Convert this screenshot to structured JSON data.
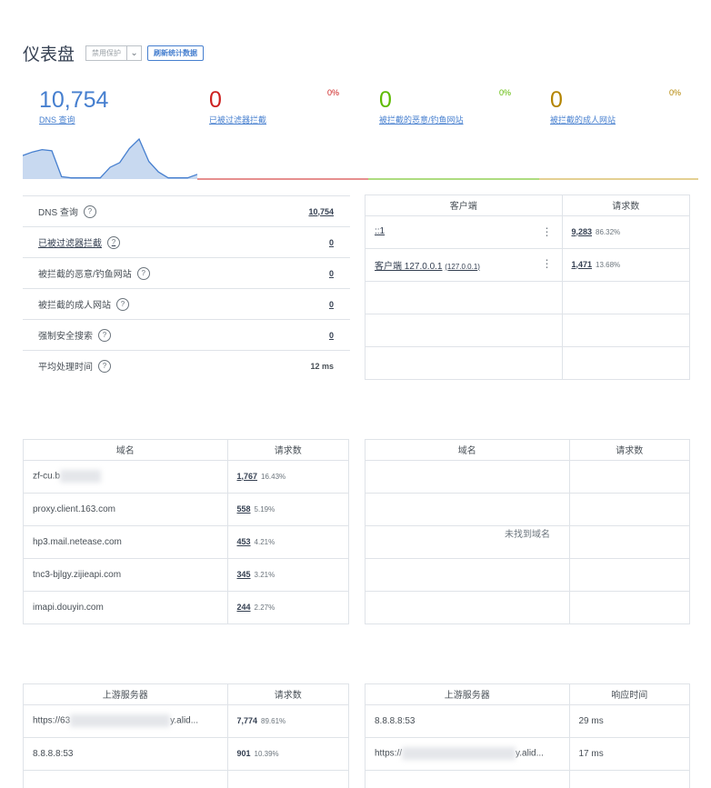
{
  "header": {
    "title": "仪表盘",
    "protection_label": "禁用保护",
    "refresh_label": "刷新统计数据"
  },
  "stats_tiles": {
    "dns": {
      "value": "10,754",
      "label": "DNS 查询"
    },
    "filtered": {
      "value": "0",
      "label": "已被过滤器拦截",
      "percent": "0%"
    },
    "malware": {
      "value": "0",
      "label": "被拦截的恶意/钓鱼网站",
      "percent": "0%"
    },
    "adult": {
      "value": "0",
      "label": "被拦截的成人网站",
      "percent": "0%"
    }
  },
  "sparkline": {
    "values": [
      20,
      23,
      25,
      24,
      2,
      1,
      1,
      1,
      1,
      10,
      14,
      26,
      34,
      15,
      6,
      1,
      1,
      1,
      4
    ]
  },
  "general_stats": [
    {
      "label": "DNS 查询",
      "value": "10,754",
      "label_link": false,
      "value_link": true
    },
    {
      "label": "已被过滤器拦截",
      "value": "0",
      "label_link": true,
      "value_link": true
    },
    {
      "label": "被拦截的恶意/钓鱼网站",
      "value": "0",
      "label_link": false,
      "value_link": true
    },
    {
      "label": "被拦截的成人网站",
      "value": "0",
      "label_link": false,
      "value_link": true
    },
    {
      "label": "强制安全搜索",
      "value": "0",
      "label_link": false,
      "value_link": true
    },
    {
      "label": "平均处理时间",
      "value": "12 ms",
      "label_link": false,
      "value_link": false
    }
  ],
  "help_icon": "?",
  "top_clients": {
    "col_client": "客户端",
    "col_requests": "请求数",
    "rows": [
      {
        "name": "::1",
        "sub": "",
        "count": "9,283",
        "percent": "86.32%"
      },
      {
        "name": "客户端 127.0.0.1",
        "sub": "(127.0.0.1)",
        "count": "1,471",
        "percent": "13.68%"
      }
    ]
  },
  "top_queried": {
    "col_domain": "域名",
    "col_requests": "请求数",
    "rows": [
      {
        "domain": "zf-cu.b",
        "count": "1,767",
        "percent": "16.43%"
      },
      {
        "domain": "proxy.client.163.com",
        "count": "558",
        "percent": "5.19%"
      },
      {
        "domain": "hp3.mail.netease.com",
        "count": "453",
        "percent": "4.21%"
      },
      {
        "domain": "tnc3-bjlgy.zijieapi.com",
        "count": "345",
        "percent": "3.21%"
      },
      {
        "domain": "imapi.douyin.com",
        "count": "244",
        "percent": "2.27%"
      }
    ]
  },
  "top_blocked": {
    "col_domain": "域名",
    "col_requests": "请求数",
    "empty": "未找到域名"
  },
  "upstreams": {
    "col_server": "上游服务器",
    "col_requests": "请求数",
    "rows": [
      {
        "server_prefix": "https://63",
        "server_suffix": "y.alid...",
        "count": "7,774",
        "percent": "89.61%"
      },
      {
        "server_prefix": "8.8.8.8:53",
        "server_suffix": "",
        "count": "901",
        "percent": "10.39%"
      }
    ]
  },
  "upstream_times": {
    "col_server": "上游服务器",
    "col_time": "响应时间",
    "rows": [
      {
        "server_prefix": "8.8.8.8:53",
        "server_suffix": "",
        "time": "29 ms"
      },
      {
        "server_prefix": "https://",
        "server_suffix": "y.alid...",
        "time": "17 ms"
      }
    ]
  },
  "colors": {
    "blue": "#467fcf",
    "red": "#cd201f",
    "green": "#5eba00",
    "yellow": "#b38400"
  }
}
